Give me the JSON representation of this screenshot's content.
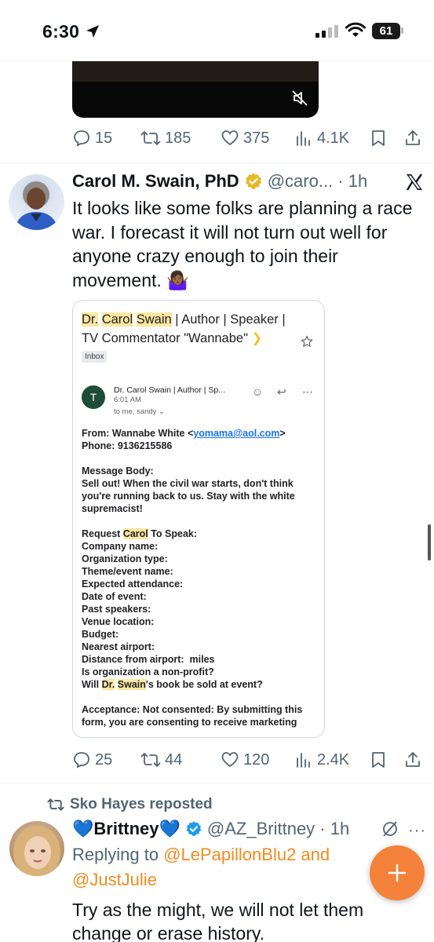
{
  "status_bar": {
    "time": "6:30",
    "battery": "61"
  },
  "tweet1": {
    "stats": {
      "replies": "15",
      "reposts": "185",
      "likes": "375",
      "views": "4.1K"
    }
  },
  "tweet2": {
    "name": "Carol M. Swain, PhD",
    "handle": "@caro... · 1h",
    "text": "It looks like some folks are planning a race war.  I forecast it will not turn out well for anyone crazy enough to join their movement. 🤷🏾‍♀️",
    "email": {
      "subject_parts": [
        "Dr.",
        " ",
        "Carol",
        " ",
        "Swain",
        " | Author | Speaker | TV Commentator \"Wannabe\" "
      ],
      "inbox_label": "Inbox",
      "avatar_letter": "T",
      "sender": "Dr. Carol Swain | Author | Sp...",
      "time": "6:01 AM",
      "to": "to me, sandy ⌄",
      "from_label": "From: Wannabe White <",
      "from_email": "yomama@aol.com",
      "from_end": ">",
      "phone": "Phone: 9136215586",
      "message_label": "Message Body:",
      "message": "Sell out! When the civil war starts, don't think you're running back to us. Stay with the white supremacist!",
      "request_a": "Request ",
      "request_hl": "Carol",
      "request_b": " To Speak:",
      "fields": [
        "Company name:",
        "Organization type:",
        "Theme/event name:",
        "Expected attendance:",
        "Date of event:",
        "Past speakers:",
        "Venue location:",
        "Budget:",
        "Nearest airport:",
        "Distance from airport:  miles",
        "Is organization a non-profit?"
      ],
      "book_a": "Will ",
      "book_hl1": "Dr.",
      "book_sp": " ",
      "book_hl2": "Swain",
      "book_b": "'s book be sold at event?",
      "acceptance": "Acceptance: Not consented: By submitting this form, you are consenting to receive marketing"
    },
    "stats": {
      "replies": "25",
      "reposts": "44",
      "likes": "120",
      "views": "2.4K"
    }
  },
  "tweet3": {
    "repost_label": "Sko Hayes reposted",
    "name": "💙Brittney💙",
    "handle": "@AZ_Brittney · 1h",
    "replying_label": "Replying to ",
    "mention1": "@LePapillonBlu2",
    "and_label": " and",
    "mention2": "@JustJulie",
    "text": "Try as the might, we will not let them change or erase history."
  },
  "colors": {
    "accent": "#f4823a",
    "mention": "#f28b1d",
    "verified_gold": "#e8b829",
    "verified_blue": "#1d9bf0",
    "muted": "#536471"
  }
}
